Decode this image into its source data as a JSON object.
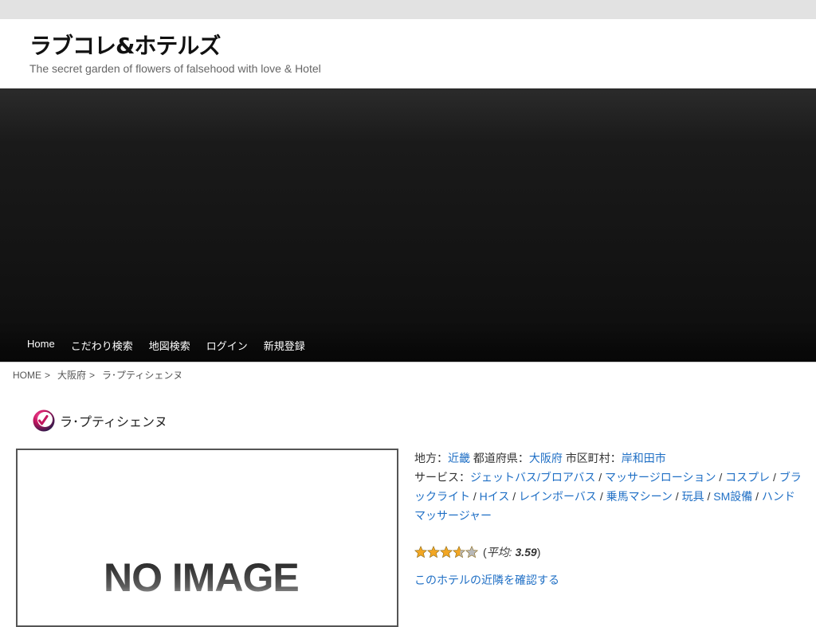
{
  "site": {
    "title": "ラブコレ&ホテルズ",
    "tagline": "The secret garden of flowers of falsehood with love & Hotel"
  },
  "nav": {
    "items": [
      "Home",
      "こだわり検索",
      "地図検索",
      "ログイン",
      "新規登録"
    ]
  },
  "breadcrumb": {
    "home": "HOME",
    "separator": ">",
    "prefecture": "大阪府",
    "current": "ラ･プティシェンヌ"
  },
  "hotel": {
    "name": "ラ･プティシェンヌ",
    "no_image_text": "NO IMAGE",
    "region_label": "地方：",
    "region": "近畿",
    "prefecture_label": "都道府県：",
    "prefecture": "大阪府",
    "city_label": "市区町村：",
    "city": "岸和田市",
    "services_label": "サービス：",
    "services": [
      "ジェットバス/ブロアバス",
      "マッサージローション",
      "コスプレ",
      "ブラックライト",
      "Hイス",
      "レインボーバス",
      "乗馬マシーン",
      "玩具",
      "SM設備",
      "ハンドマッサージャー"
    ],
    "service_separator": "/"
  },
  "rating": {
    "value": 3.59,
    "max": 5,
    "open_paren": "(",
    "avg_label": "平均:",
    "avg_value": "3.59",
    "close_paren": ")"
  },
  "nearby_link": "このホテルの近隣を確認する",
  "colors": {
    "link": "#1f6fc5",
    "star_fill": "#f2a623",
    "star_empty": "#b8b8b8"
  }
}
